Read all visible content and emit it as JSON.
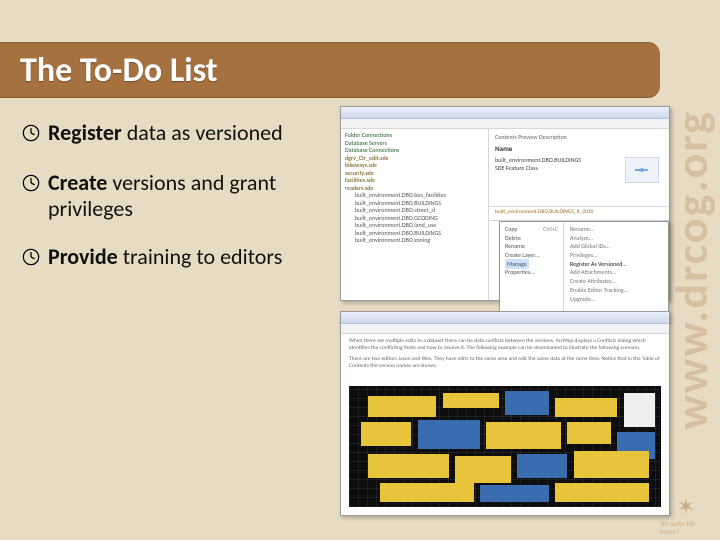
{
  "title": "The To-Do List",
  "bullets": [
    {
      "strong": "Register",
      "rest": " data as versioned"
    },
    {
      "strong": "Create",
      "rest": " versions and grant privileges"
    },
    {
      "strong": "Provide",
      "rest": " training to editors"
    }
  ],
  "sidebar_url": "www.drcog.org",
  "logo_tagline": "We make life better!",
  "arc_catalog": {
    "pane_tabs": "Contents   Preview   Description",
    "pane_header": "Name",
    "pane_item": "built_environment.DBO.BUILDINGS",
    "pane_type": "SDE Feature Class",
    "path": "built_environment.DBO.BUILDINGS_R_2010",
    "tree": [
      "Folder Connections",
      "Database Servers",
      "Database Connections",
      "dgrv_Ctr_edit.sde",
      "bikeways.sde",
      "security.sde",
      "facilities.sde",
      "readers.sde",
      "built_environment.DBO.bus_facilities",
      "built_environment.DBO.BUILDINGS",
      "built_environment.DBO.street_cl",
      "built_environment.DBO.GCODING",
      "built_environment.DBO.land_use",
      "built_environment.DBO.BUILDINGS",
      "built_environment.DBO.zoning"
    ],
    "context_menu": {
      "left": [
        "Copy",
        "Delete",
        "Rename",
        "Create Layer…",
        "Manage",
        "Properties…"
      ],
      "highlight": "Manage",
      "shortcut": "Ctrl+C",
      "right": [
        "Rename…",
        "Analyze…",
        "Add Global IDs…",
        "Privileges…",
        "Register As Versioned…",
        "Add Attachments…",
        "Create Attributes…",
        "Enable Editor Tracking…",
        "Upgrade…"
      ],
      "right_enabled": "Register As Versioned…"
    }
  },
  "conflict_window": {
    "para1": "When there are multiple edits to a dataset there can be data conflicts between the versions. ArcMap displays a Conflicts dialog which identifies the conflicting fields and how to resolve it. The following example can be downloaded to illustrate the following scenario.",
    "para2": "There are two editors Jason and Wes. They have edits to the same area and edit the same data at the same time. Notice that in the Table of Contents the version names are shown."
  }
}
